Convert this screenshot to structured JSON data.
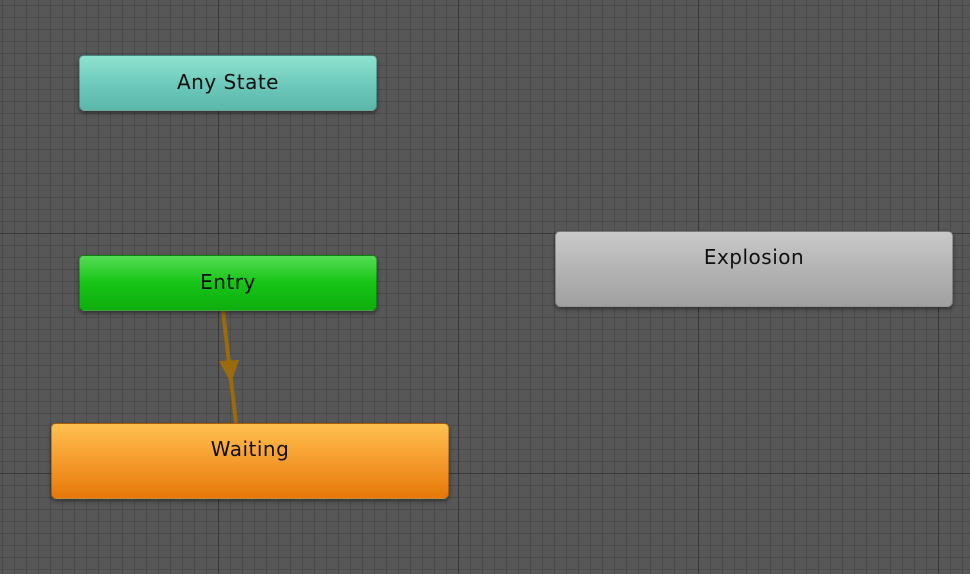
{
  "states": {
    "any_state": {
      "label": "Any State"
    },
    "entry": {
      "label": "Entry"
    },
    "waiting": {
      "label": "Waiting"
    },
    "explosion": {
      "label": "Explosion"
    }
  },
  "transitions": [
    {
      "from": "Entry",
      "to": "Waiting"
    }
  ],
  "colors": {
    "canvas_background": "#575757",
    "any_state": "#6cc8ba",
    "entry": "#16c416",
    "default_state": "#f4982a",
    "state": "#b2b2b2",
    "transition_arrow": "#9a6a0c"
  }
}
